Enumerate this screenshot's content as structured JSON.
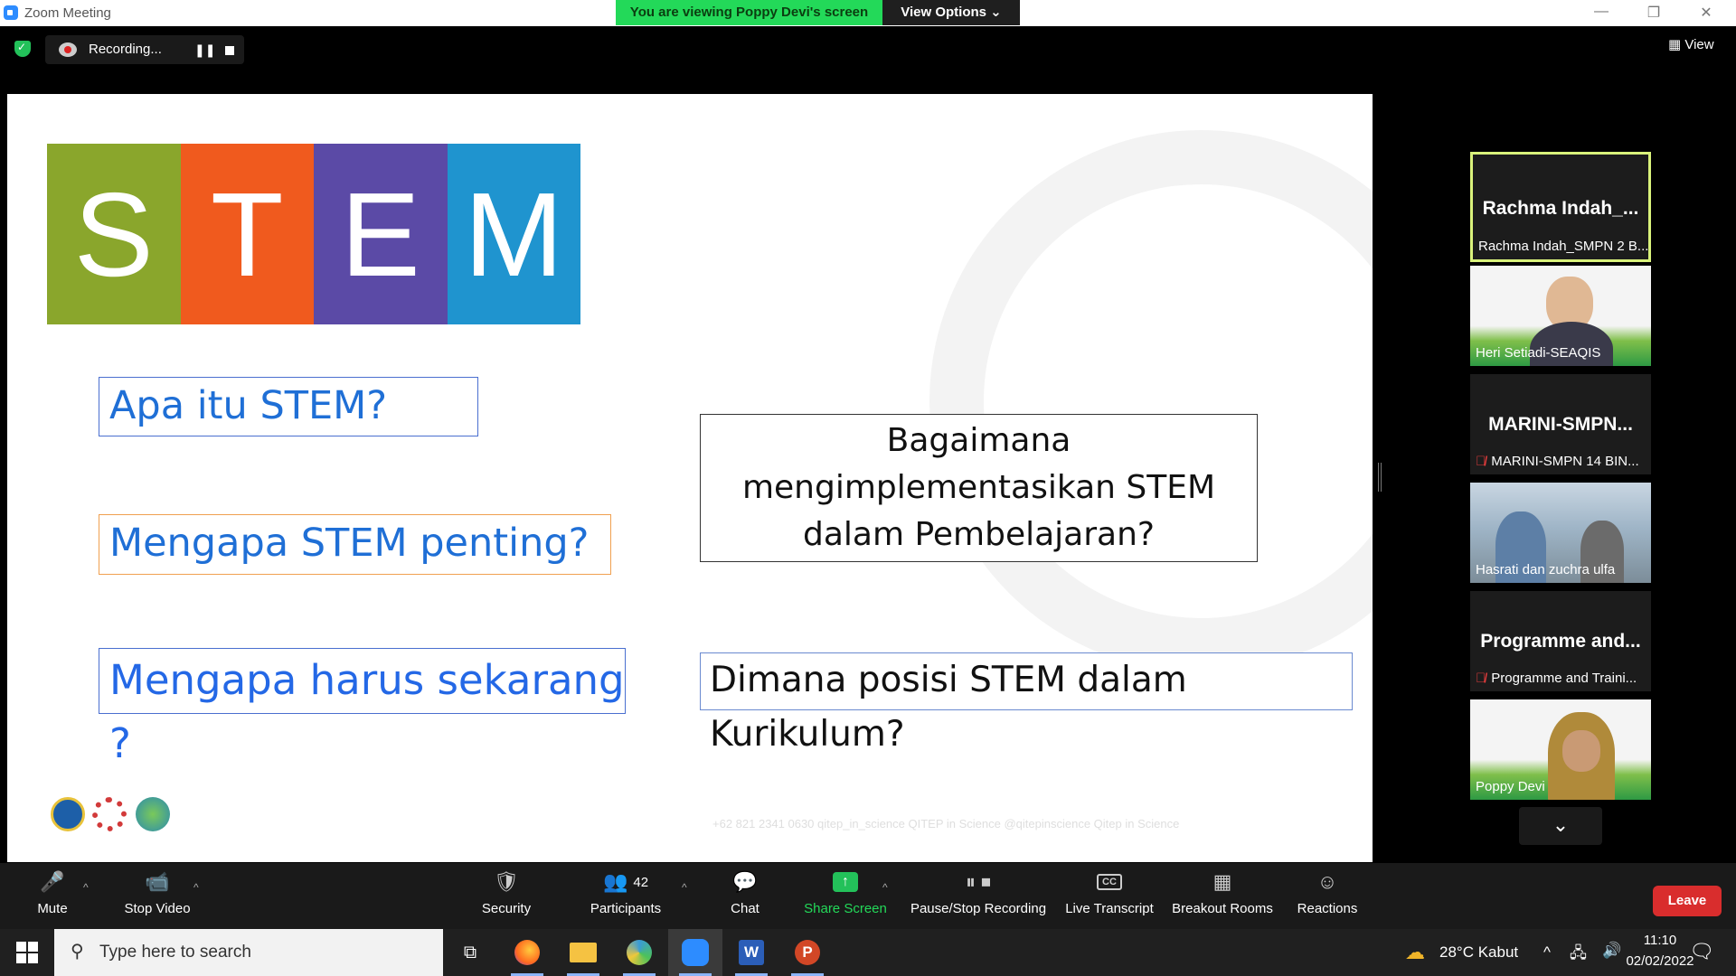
{
  "window": {
    "title": "Zoom Meeting",
    "viewing_banner": "You are viewing Poppy Devi's screen",
    "view_options": "View Options"
  },
  "top": {
    "recording_label": "Recording...",
    "view_label": "View"
  },
  "slide": {
    "logo_letters": [
      "S",
      "T",
      "E",
      "M"
    ],
    "logo_colors": [
      "#8aa62c",
      "#f05a1e",
      "#5b4aa6",
      "#1f94cf"
    ],
    "questions": {
      "q1": "Apa itu STEM?",
      "q2": "Mengapa STEM penting?",
      "q3": "Mengapa harus sekarang ?",
      "q4_line1": "Bagaimana",
      "q4_line2": "mengimplementasikan STEM",
      "q4_line3": "dalam Pembelajaran?",
      "q5": "Dimana posisi STEM dalam Kurikulum?"
    },
    "footer_social": "+62 821 2341 0630   qitep_in_science   QITEP in Science   @qitepinscience   Qitep in Science"
  },
  "participants": [
    {
      "big_name": "Rachma  Indah_...",
      "name": "Rachma Indah_SMPN 2 B...",
      "muted": false,
      "video": false,
      "active": true
    },
    {
      "big_name": "",
      "name": "Heri Setiadi-SEAQIS",
      "muted": false,
      "video": true,
      "active": false
    },
    {
      "big_name": "MARINI-SMPN...",
      "name": "MARINI-SMPN 14 BIN...",
      "muted": true,
      "video": false,
      "active": false
    },
    {
      "big_name": "",
      "name": "Hasrati dan zuchra ulfa",
      "muted": false,
      "video": true,
      "active": false
    },
    {
      "big_name": "Programme  and...",
      "name": "Programme and Traini...",
      "muted": true,
      "video": false,
      "active": false
    },
    {
      "big_name": "",
      "name": "Poppy Devi",
      "muted": false,
      "video": true,
      "active": false
    }
  ],
  "toolbar": {
    "mute": "Mute",
    "stop_video": "Stop Video",
    "security": "Security",
    "participants": "Participants",
    "participants_count": "42",
    "chat": "Chat",
    "share_screen": "Share Screen",
    "pause_stop_recording": "Pause/Stop Recording",
    "live_transcript": "Live Transcript",
    "breakout_rooms": "Breakout Rooms",
    "reactions": "Reactions",
    "leave": "Leave"
  },
  "taskbar": {
    "search_placeholder": "Type here to search",
    "weather": "28°C  Kabut",
    "time": "11:10",
    "date": "02/02/2022"
  },
  "colors": {
    "share_green": "#23d959",
    "leave_red": "#d92d2d",
    "active_speaker": "#d9f27b"
  }
}
